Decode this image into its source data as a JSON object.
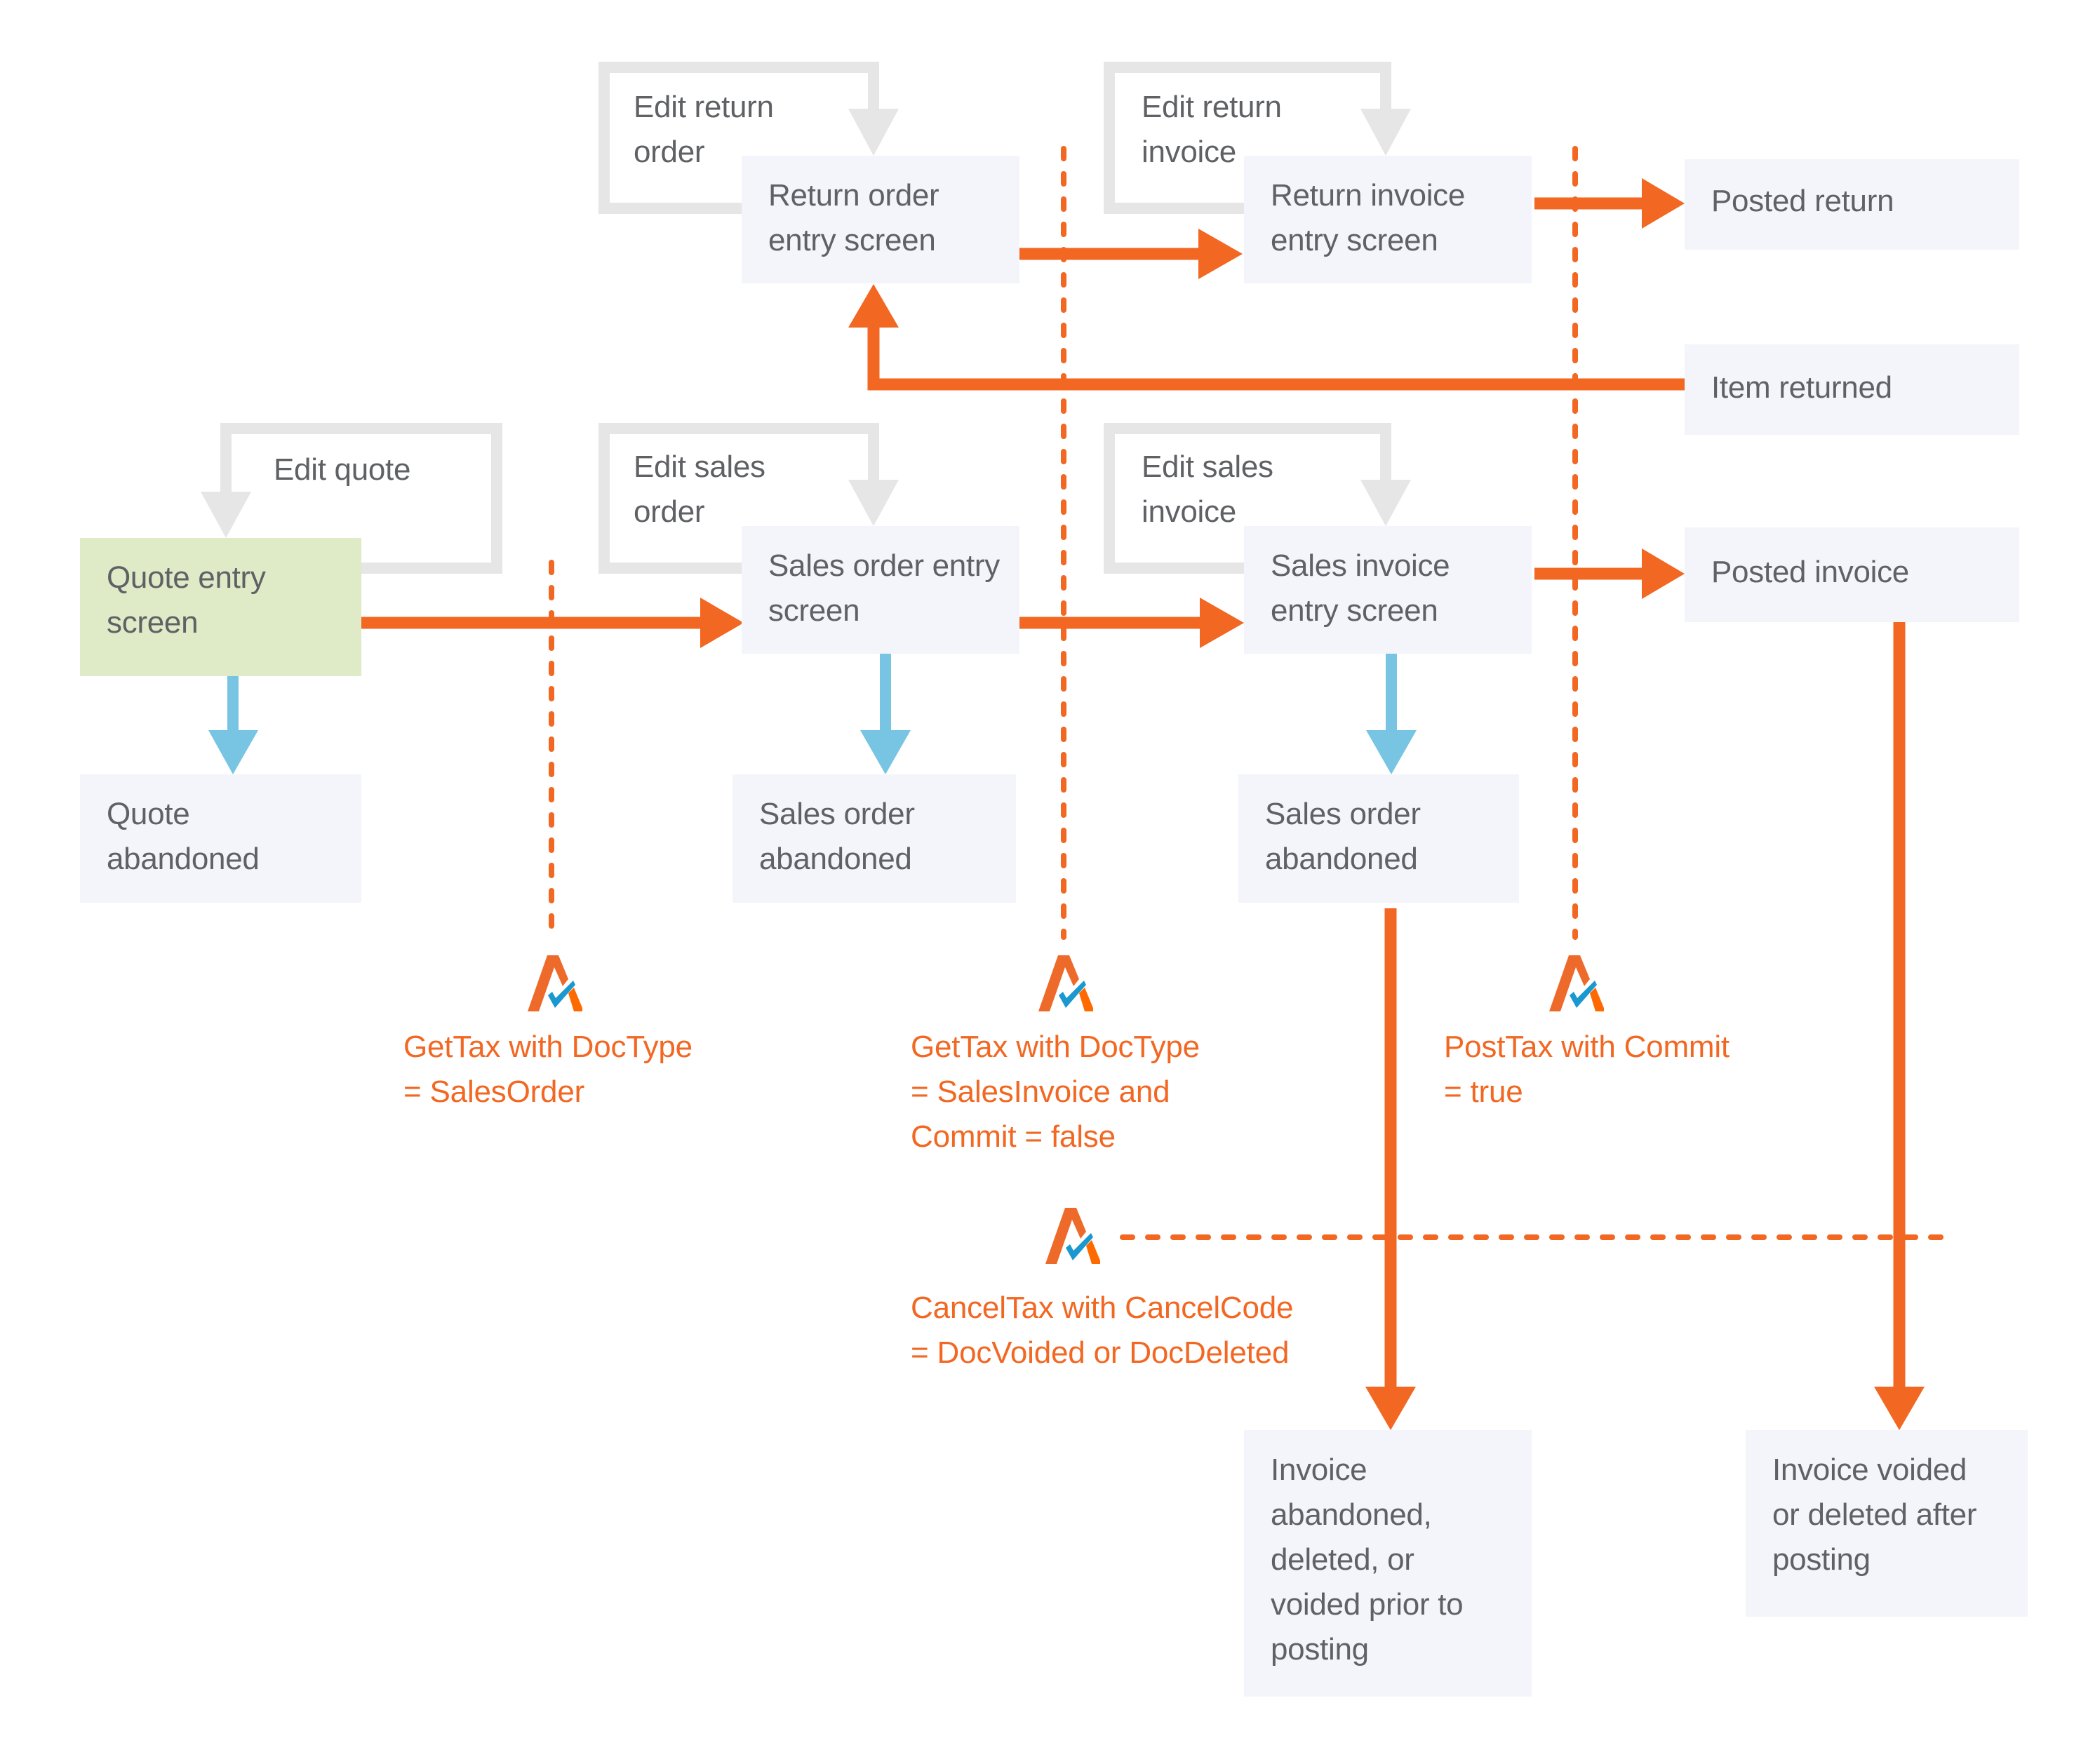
{
  "diagram": {
    "type": "tax-document-lifecycle-flowchart",
    "colors": {
      "flow_arrow": "#f26722",
      "abandon_arrow": "#77c4e3",
      "loop_arrow": "#e6e6e6",
      "node_fill": "#f4f5fa",
      "start_node_fill": "#dfeac6",
      "node_text": "#5f6165",
      "api_text": "#f26722",
      "icon_orange": "#ee6a2a",
      "icon_blue": "#1b98d0"
    },
    "nodes": {
      "quote_entry": {
        "lines": [
          "Quote entry",
          "screen"
        ]
      },
      "quote_abandoned": {
        "lines": [
          "Quote",
          "abandoned"
        ]
      },
      "return_order_entry": {
        "lines": [
          "Return order",
          "entry screen"
        ]
      },
      "return_invoice_entry": {
        "lines": [
          "Return invoice",
          "entry screen"
        ]
      },
      "posted_return": {
        "lines": [
          "Posted return"
        ]
      },
      "item_returned": {
        "lines": [
          "Item returned"
        ]
      },
      "sales_order_entry": {
        "lines": [
          "Sales order entry",
          "screen"
        ]
      },
      "sales_invoice_entry": {
        "lines": [
          "Sales invoice",
          "entry screen"
        ]
      },
      "posted_invoice": {
        "lines": [
          "Posted invoice"
        ]
      },
      "sales_order_abandoned_1": {
        "lines": [
          "Sales order",
          "abandoned"
        ]
      },
      "sales_order_abandoned_2": {
        "lines": [
          "Sales order",
          "abandoned"
        ]
      },
      "invoice_abandoned": {
        "lines": [
          "Invoice",
          "abandoned,",
          "deleted, or",
          "voided prior to",
          "posting"
        ]
      },
      "invoice_voided": {
        "lines": [
          "Invoice voided",
          "or deleted after",
          "posting"
        ]
      }
    },
    "loops": {
      "edit_quote": {
        "lines": [
          "Edit quote"
        ]
      },
      "edit_return_order": {
        "lines": [
          "Edit return",
          "order"
        ]
      },
      "edit_return_invoice": {
        "lines": [
          "Edit return",
          "invoice"
        ]
      },
      "edit_sales_order": {
        "lines": [
          "Edit sales",
          "order"
        ]
      },
      "edit_sales_invoice": {
        "lines": [
          "Edit sales",
          "invoice"
        ]
      }
    },
    "api_calls": {
      "gettax_salesorder": {
        "icon": "avalara-check-icon",
        "lines": [
          "GetTax with DocType",
          "= SalesOrder"
        ]
      },
      "gettax_salesinvoice": {
        "icon": "avalara-check-icon",
        "lines": [
          "GetTax with DocType",
          "= SalesInvoice and",
          "Commit = false"
        ]
      },
      "posttax_commit": {
        "icon": "avalara-check-icon",
        "lines": [
          "PostTax with Commit",
          "= true"
        ]
      },
      "canceltax": {
        "icon": "avalara-check-icon",
        "lines": [
          "CancelTax with CancelCode",
          "= DocVoided or DocDeleted"
        ]
      }
    },
    "edges": [
      {
        "from": "quote_entry",
        "to": "sales_order_entry",
        "kind": "flow"
      },
      {
        "from": "sales_order_entry",
        "to": "sales_invoice_entry",
        "kind": "flow"
      },
      {
        "from": "sales_invoice_entry",
        "to": "posted_invoice",
        "kind": "flow"
      },
      {
        "from": "return_order_entry",
        "to": "return_invoice_entry",
        "kind": "flow"
      },
      {
        "from": "return_invoice_entry",
        "to": "posted_return",
        "kind": "flow"
      },
      {
        "from": "item_returned",
        "to": "return_order_entry",
        "kind": "flow"
      },
      {
        "from": "quote_entry",
        "to": "quote_abandoned",
        "kind": "abandon"
      },
      {
        "from": "sales_order_entry",
        "to": "sales_order_abandoned_1",
        "kind": "abandon"
      },
      {
        "from": "sales_invoice_entry",
        "to": "sales_order_abandoned_2",
        "kind": "abandon"
      },
      {
        "from": "sales_order_abandoned_2",
        "to": "invoice_abandoned",
        "kind": "flow"
      },
      {
        "from": "posted_invoice",
        "to": "invoice_voided",
        "kind": "flow"
      }
    ]
  }
}
